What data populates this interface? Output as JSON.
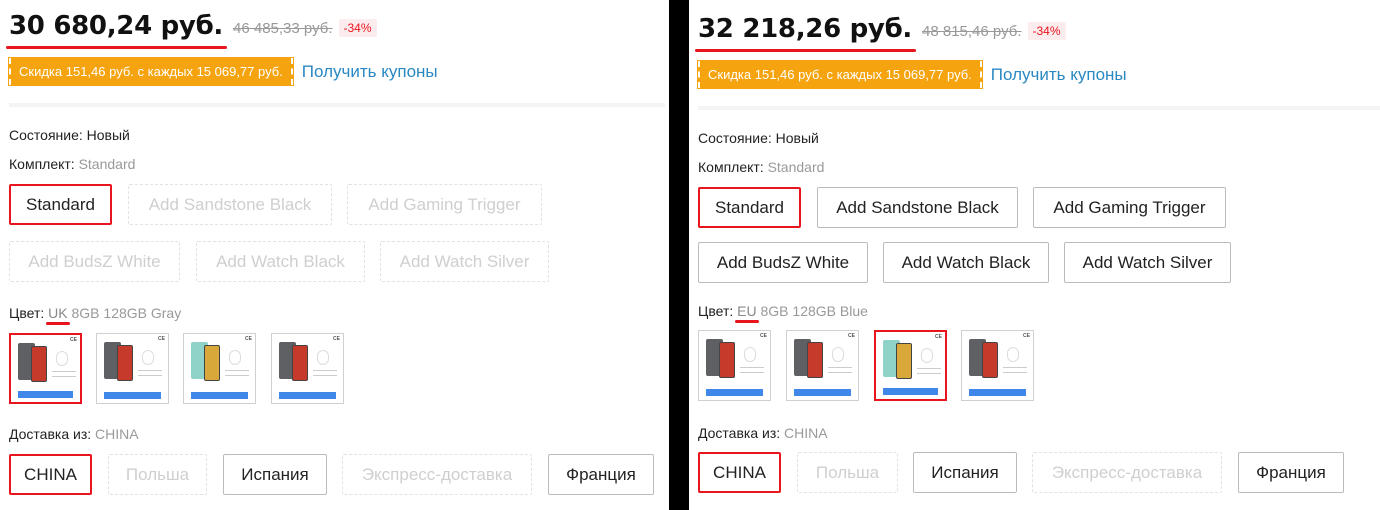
{
  "left": {
    "price": "30 680,24 руб.",
    "old_price": "46 485,33 руб.",
    "discount": "-34%",
    "coupon": "Скидка 151,46 руб. с каждых 15 069,77 руб.",
    "coupon_link": "Получить купоны",
    "condition_label": "Состояние:",
    "condition_value": "Новый",
    "bundle_label": "Комплект:",
    "bundle_value": "Standard",
    "bundle_options": [
      "Standard",
      "Add Sandstone Black",
      "Add Gaming Trigger",
      "Add BudsZ White",
      "Add Watch Black",
      "Add Watch Silver"
    ],
    "color_label": "Цвет:",
    "color_region": "UK",
    "color_value": "8GB 128GB Gray",
    "ship_label": "Доставка из:",
    "ship_value": "CHINA",
    "ship_options": [
      "CHINA",
      "Польша",
      "Испания",
      "Экспресс-доставка",
      "Франция"
    ]
  },
  "right": {
    "price": "32 218,26 руб.",
    "old_price": "48 815,46 руб.",
    "discount": "-34%",
    "coupon": "Скидка 151,46 руб. с каждых 15 069,77 руб.",
    "coupon_link": "Получить купоны",
    "condition_label": "Состояние:",
    "condition_value": "Новый",
    "bundle_label": "Комплект:",
    "bundle_value": "Standard",
    "bundle_options": [
      "Standard",
      "Add Sandstone Black",
      "Add Gaming Trigger",
      "Add BudsZ White",
      "Add Watch Black",
      "Add Watch Silver"
    ],
    "color_label": "Цвет:",
    "color_region": "EU",
    "color_value": "8GB 128GB Blue",
    "ship_label": "Доставка из:",
    "ship_value": "CHINA",
    "ship_options": [
      "CHINA",
      "Польша",
      "Испания",
      "Экспресс-доставка",
      "Франция"
    ]
  },
  "thumb_ce": "CE",
  "colors": {
    "accent_red": "#e8141e",
    "coupon_orange": "#f5a40f",
    "link_blue": "#2a89c3",
    "phone_gray": "#5f6063",
    "phone_blue": "#8fd3c8"
  }
}
